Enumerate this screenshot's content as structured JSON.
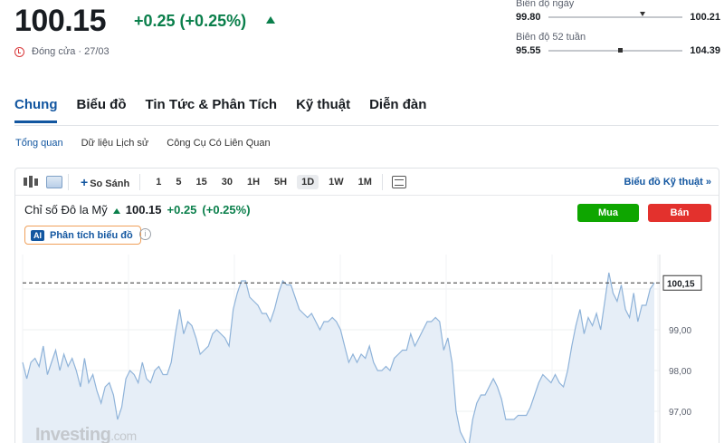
{
  "quote": {
    "price": "100.15",
    "change": "+0.25 (+0.25%)",
    "status": "Đóng cửa · 27/03",
    "status_icon": "clock-icon"
  },
  "ranges": [
    {
      "title": "Biên độ ngày",
      "low": "99.80",
      "high": "100.21",
      "marker_fraction": 0.68
    },
    {
      "title": "Biên độ 52 tuần",
      "low": "95.55",
      "high": "104.39",
      "marker_fraction": 0.52
    }
  ],
  "tabs": [
    "Chung",
    "Biểu đồ",
    "Tin Tức & Phân Tích",
    "Kỹ thuật",
    "Diễn đàn"
  ],
  "subtabs": [
    "Tổng quan",
    "Dữ liệu Lịch sử",
    "Công Cụ Có Liên Quan"
  ],
  "toolbar": {
    "compare": "So Sánh",
    "timeframes": [
      "1",
      "5",
      "15",
      "30",
      "1H",
      "5H",
      "1D",
      "1W",
      "1M"
    ],
    "selected_timeframe": "1D",
    "tech_chart": "Biểu đồ Kỹ thuật »"
  },
  "instrument": {
    "name": "Chỉ số Đô la Mỹ",
    "price": "100.15",
    "change": "+0.25",
    "change_pct": "(+0.25%)"
  },
  "buttons": {
    "buy": "Mua",
    "sell": "Bán"
  },
  "ai": {
    "badge": "AI",
    "label": "Phân tích biểu đồ"
  },
  "watermark": {
    "brand": "Investing",
    "suffix": ".com"
  },
  "colors": {
    "accent": "#1256a0",
    "up": "#0a7f4b",
    "buy": "#0ea600",
    "sell": "#e3312d",
    "line": "#8fb3d9"
  },
  "chart_data": {
    "type": "area",
    "y_ticks": [
      "99,00",
      "98,00",
      "97,00"
    ],
    "last_value_label": "100,15",
    "last_value": 100.15,
    "ylim": [
      96.2,
      101.2
    ],
    "grid": true,
    "values": [
      98.2,
      97.8,
      98.2,
      98.3,
      98.1,
      98.6,
      97.9,
      98.2,
      98.5,
      98.0,
      98.4,
      98.1,
      98.3,
      98.0,
      97.6,
      98.3,
      97.7,
      97.9,
      97.5,
      97.2,
      97.6,
      97.7,
      97.4,
      96.8,
      97.1,
      97.8,
      98.0,
      97.9,
      97.7,
      98.2,
      97.8,
      97.7,
      98.0,
      98.1,
      97.9,
      97.9,
      98.2,
      98.9,
      99.5,
      98.9,
      99.2,
      99.1,
      98.8,
      98.4,
      98.5,
      98.6,
      98.9,
      99.0,
      98.9,
      98.8,
      98.6,
      99.5,
      99.9,
      100.2,
      100.2,
      99.8,
      99.7,
      99.6,
      99.4,
      99.4,
      99.2,
      99.5,
      99.9,
      100.2,
      100.1,
      100.1,
      99.8,
      99.5,
      99.4,
      99.3,
      99.4,
      99.2,
      99.0,
      99.2,
      99.2,
      99.3,
      99.2,
      99.0,
      98.6,
      98.2,
      98.4,
      98.2,
      98.4,
      98.3,
      98.6,
      98.2,
      98.0,
      98.0,
      98.1,
      98.0,
      98.3,
      98.4,
      98.5,
      98.5,
      98.9,
      98.6,
      98.8,
      99.0,
      99.2,
      99.2,
      99.3,
      99.2,
      98.5,
      98.8,
      98.2,
      97.0,
      96.5,
      96.3,
      96.1,
      96.8,
      97.2,
      97.4,
      97.4,
      97.6,
      97.8,
      97.6,
      97.3,
      96.8,
      96.8,
      96.8,
      96.9,
      96.9,
      96.9,
      97.1,
      97.4,
      97.7,
      97.9,
      97.8,
      97.7,
      97.9,
      97.7,
      97.6,
      98.0,
      98.6,
      99.1,
      99.5,
      98.9,
      99.3,
      99.1,
      99.4,
      99.0,
      99.7,
      100.4,
      99.9,
      99.7,
      100.1,
      99.5,
      99.3,
      99.9,
      99.2,
      99.6,
      99.6,
      100.0,
      100.15
    ]
  }
}
